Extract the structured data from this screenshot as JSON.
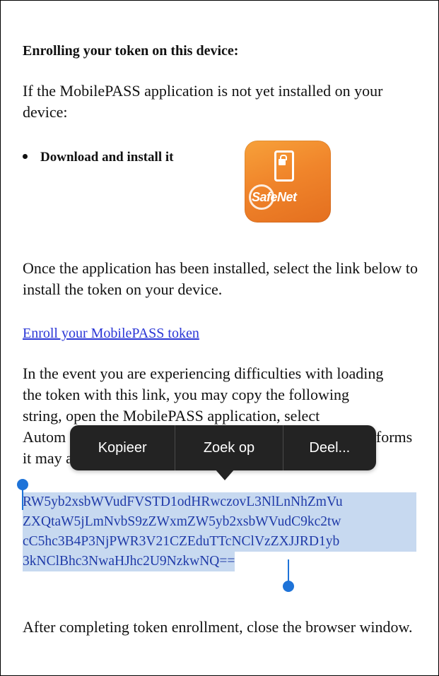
{
  "heading": "Enrolling your token on this device:",
  "intro": "If the MobilePASS application is not yet installed on your device:",
  "bullet": "Download and install it",
  "app_icon": {
    "name": "safenet-app-icon",
    "brand_text": "SafeNet",
    "color": "#f0852b"
  },
  "installed_text": "Once the application has been installed, select the link below to install the token on your device.",
  "enroll_link": "Enroll your MobilePASS token",
  "difficulty_text": "In the event you are experiencing difficulties with loading the token with this link, you may copy the following string, open the MobilePASS application, select Autom… platforms it may …",
  "difficulty_lines": [
    "In the event you are experiencing difficulties with loading",
    "the token with this link, you may copy the following",
    "string, open the MobilePASS application, select",
    "Autom",
    "atforms",
    "it may a"
  ],
  "token_string_lines": [
    "RW5yb2xsbWVudFVSTD1odHRwczovL3NlLnNhZmVu",
    "ZXQtaW5jLmNvbS9zZWxmZW5yb2xsbWVudC9kc2tw",
    "cC5hc3B4P3NjPWR3V21CZEduTTcNClVzZXJJRD1yb",
    "3kNClBhc3NwaHJhc2U9NzkwNQ=="
  ],
  "closing_text": "After completing token enrollment, close the browser window.",
  "context_menu": {
    "items": [
      "Kopieer",
      "Zoek op",
      "Deel..."
    ],
    "background": "#232323"
  },
  "selection_color": "#c7d9f0",
  "handle_color": "#1e73d8",
  "link_color": "#2a36d6"
}
